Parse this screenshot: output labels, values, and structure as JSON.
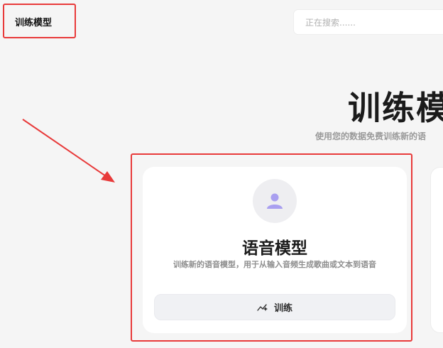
{
  "topbar": {
    "title": "训练模型"
  },
  "search": {
    "placeholder": "正在搜索......"
  },
  "hero": {
    "title": "训练模",
    "subtitle": "使用您的数据免费训练新的语"
  },
  "cards": [
    {
      "icon": "person-icon",
      "title": "语音模型",
      "description": "训练新的语音模型，用于从输入音频生成歌曲或文本到语音",
      "button": {
        "icon": "sparkle-icon",
        "label": "训练"
      }
    }
  ],
  "colors": {
    "annotation": "#e83a3a",
    "accent": "#9b8fe6",
    "background": "#f5f5f5"
  }
}
